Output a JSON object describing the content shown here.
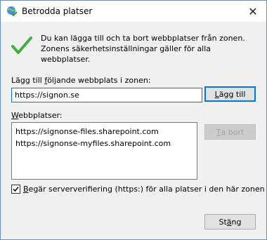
{
  "window": {
    "title": "Betrodda platser"
  },
  "info": {
    "text": "Du kan lägga till och ta bort webbplatser från zonen. Zonens säkerhetsinställningar gäller för alla webbplatser."
  },
  "add": {
    "label_pre": "Lägg till ",
    "label_accel": "f",
    "label_post": "öljande webbplats i zonen:",
    "value": "https://signon.se",
    "button_accel": "L",
    "button_rest": "ägg till"
  },
  "sites": {
    "label_accel": "W",
    "label_rest": "ebbplatser:",
    "items": [
      "https://signonse-files.sharepoint.com",
      "https://signonse-myfiles.sharepoint.com"
    ],
    "remove_accel": "T",
    "remove_rest": "a bort"
  },
  "verify": {
    "checked": true,
    "label_accel": "B",
    "label_rest": "egär serververifiering (https:) för alla platser i den här zonen"
  },
  "close": {
    "label_pre": "St",
    "label_accel": "ä",
    "label_post": "ng"
  },
  "icons": {
    "window": "globe-check-icon",
    "info": "checkmark-icon",
    "close": "close-icon"
  },
  "colors": {
    "focus": "#0078d7",
    "check": "#3fae3f"
  }
}
